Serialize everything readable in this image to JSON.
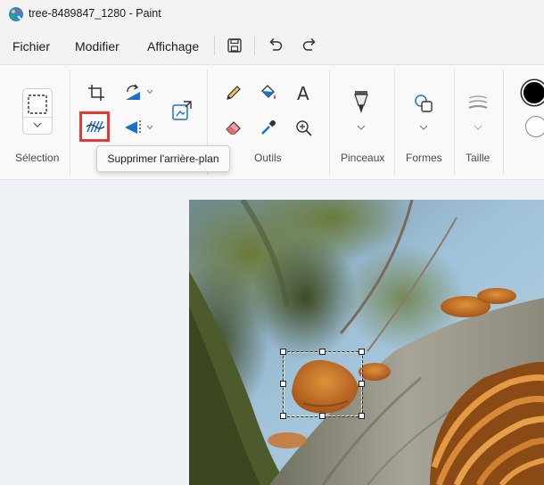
{
  "window": {
    "title": "tree-8489847_1280 - Paint"
  },
  "menu": {
    "file": "Fichier",
    "edit": "Modifier",
    "view": "Affichage"
  },
  "ribbon": {
    "groups": {
      "selection": "Sélection",
      "tools": "Outils",
      "brushes": "Pinceaux",
      "shapes": "Formes",
      "size": "Taille"
    }
  },
  "tooltip": {
    "text": "Supprimer l'arrière-plan"
  },
  "colors": {
    "accent": "#0067c0",
    "primary_color": "#000000",
    "secondary_color": "#ffffff",
    "highlight": "#e53935"
  },
  "icons": {
    "app": "paint-icon",
    "save": "save-icon",
    "undo": "undo-icon",
    "redo": "redo-icon",
    "crop": "crop-icon",
    "rotate": "rotate-icon",
    "remove_background": "remove-background-icon",
    "flip": "flip-icon",
    "resize": "resize-icon",
    "pencil": "pencil-icon",
    "fill": "fill-icon",
    "text": "text-icon",
    "eraser": "eraser-icon",
    "color_picker": "color-picker-icon",
    "magnifier": "magnifier-icon",
    "brush": "brush-icon",
    "shapes": "shapes-icon",
    "size": "size-icon"
  }
}
